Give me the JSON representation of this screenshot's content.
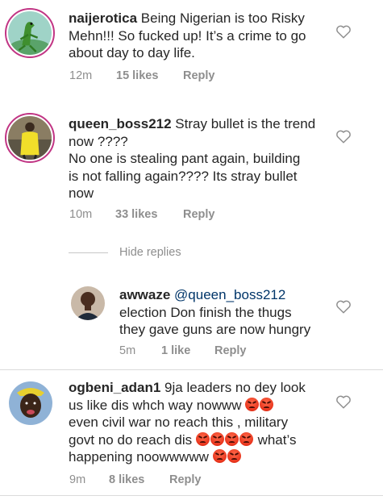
{
  "comments": [
    {
      "username": "naijerotica",
      "lines": [
        "Being Nigerian is too Risky",
        "Mehn!!! So fucked up! It’s a crime to go",
        "about day to day life."
      ],
      "time": "12m",
      "likes": "15 likes",
      "reply": "Reply",
      "avatar_icon": "lizard-avatar-icon"
    },
    {
      "username": "queen_boss212",
      "lines": [
        "Stray bullet is the trend",
        "now ????",
        "No one is stealing pant again, building",
        "is not falling again???? Its stray bullet",
        "now"
      ],
      "time": "10m",
      "likes": "33 likes",
      "reply": "Reply",
      "avatar_icon": "person-yellow-avatar-icon"
    }
  ],
  "hide_replies": "Hide replies",
  "reply_comment": {
    "username": "awwaze",
    "mention": "@queen_boss212",
    "lines": [
      "election Don finish the thugs",
      "they gave guns are now hungry"
    ],
    "time": "5m",
    "likes": "1 like",
    "reply": "Reply"
  },
  "last_comment": {
    "username": "ogbeni_adan1",
    "line1": "9ja leaders no dey look",
    "line2": "us like dis whch way nowww",
    "line3": "even civil war no reach this , military",
    "line4a": "govt no do reach dis",
    "line4b": " what’s",
    "line5": "happening noowwwww",
    "time": "9m",
    "likes": "8 likes",
    "reply": "Reply"
  },
  "colors": {
    "text": "#262626",
    "muted": "#8e8e8e",
    "mention": "#003569",
    "story_ring": "#c13584"
  },
  "emoji_name": "angry-face-emoji"
}
